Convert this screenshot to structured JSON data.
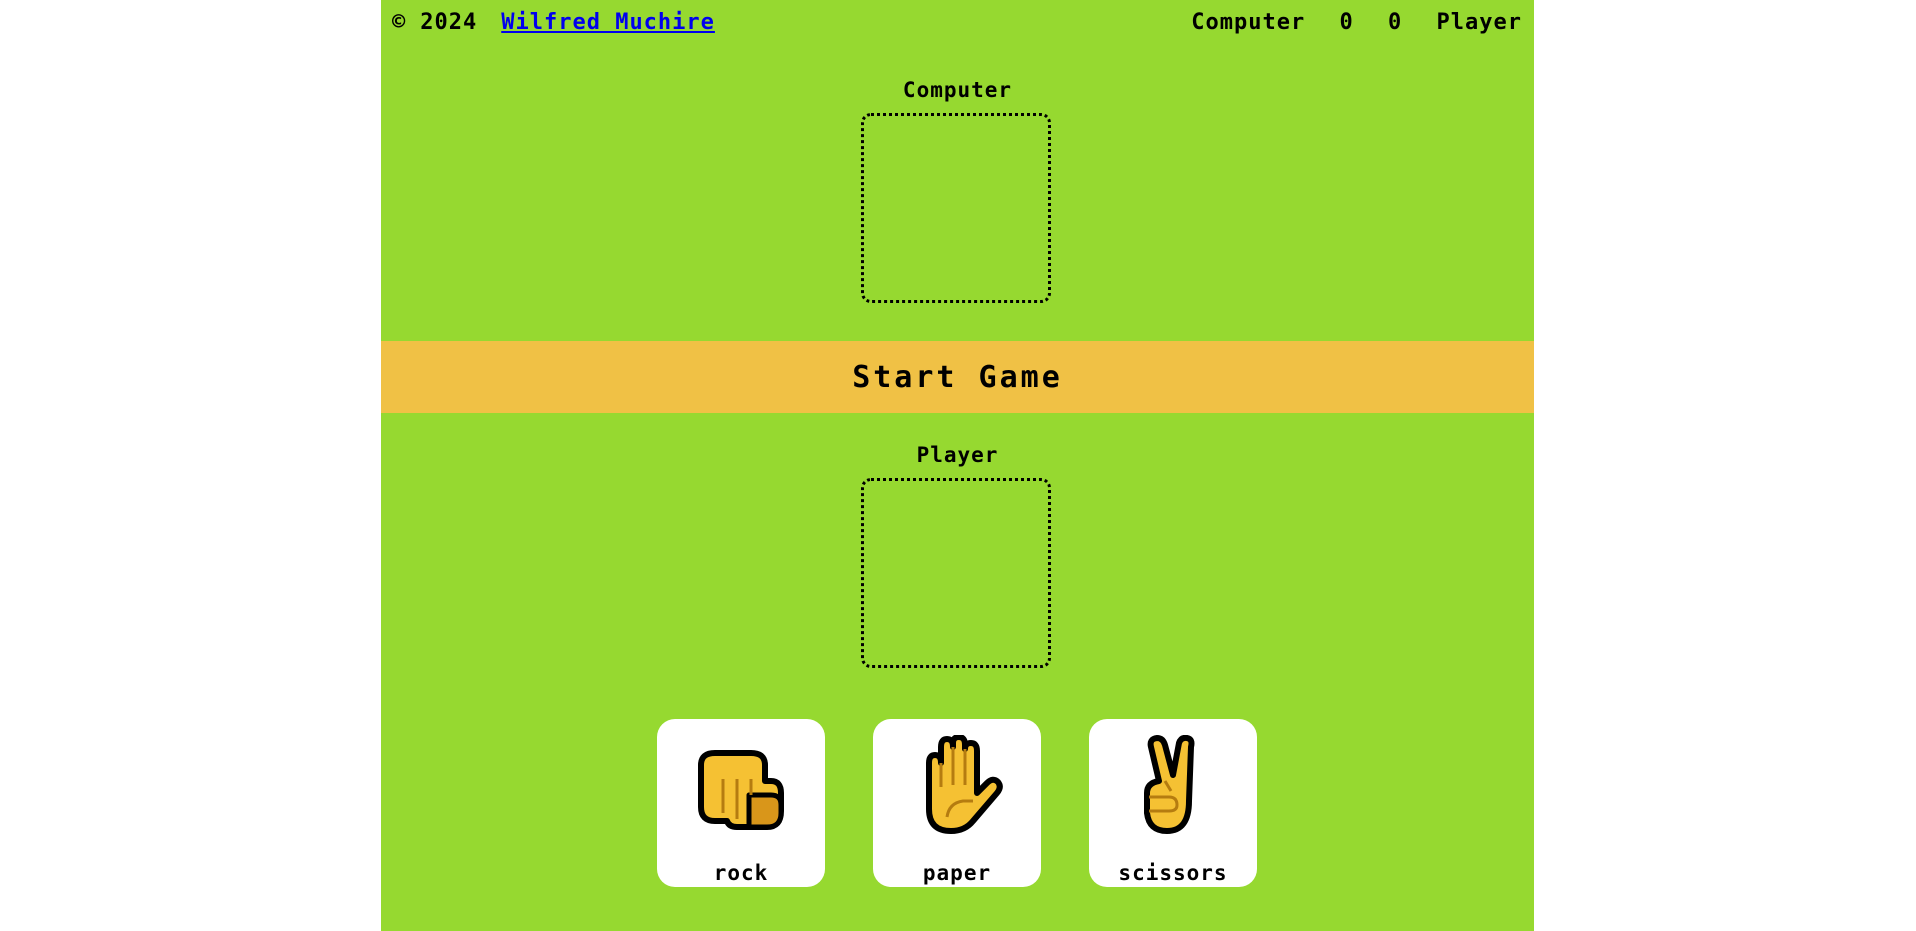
{
  "footer": {
    "copyright_symbol": "©",
    "year": "2024",
    "author": "Wilfred Muchire"
  },
  "scoreboard": {
    "computer_label": "Computer",
    "computer_score": "0",
    "player_score": "0",
    "player_label": "Player"
  },
  "computer_section": {
    "label": "Computer"
  },
  "start_button": {
    "label": "Start Game"
  },
  "player_section": {
    "label": "Player"
  },
  "choices": [
    {
      "label": "rock",
      "icon": "rock-fist-icon"
    },
    {
      "label": "paper",
      "icon": "paper-hand-icon"
    },
    {
      "label": "scissors",
      "icon": "scissors-hand-icon"
    }
  ],
  "colors": {
    "background": "#96d930",
    "start_bar": "#f0c145",
    "hand_fill": "#f5c133",
    "hand_shade": "#d9961a",
    "link": "#0000ee"
  }
}
